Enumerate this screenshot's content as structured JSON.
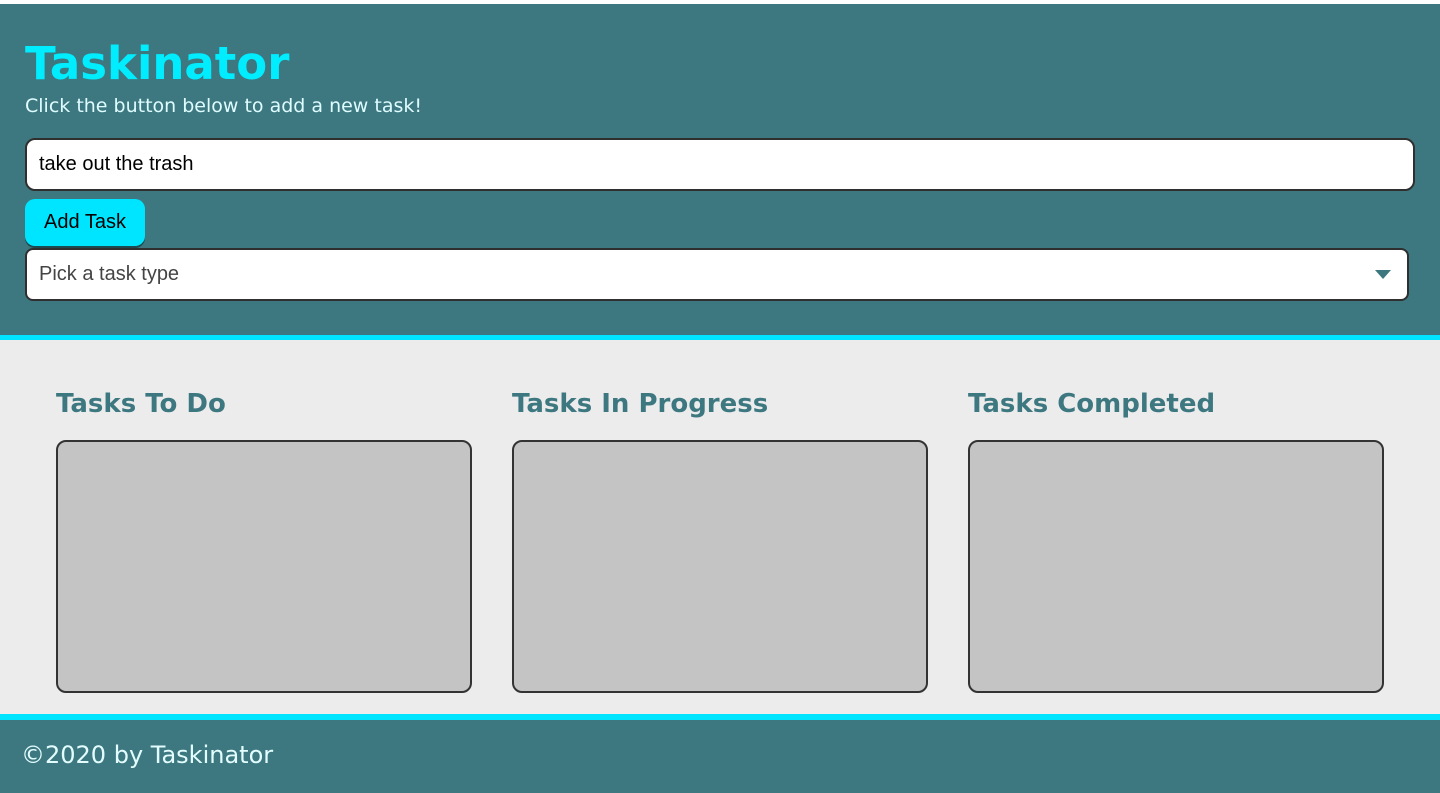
{
  "header": {
    "title": "Taskinator",
    "subtitle": "Click the button below to add a new task!"
  },
  "form": {
    "task_name_value": "take out the trash",
    "add_task_label": "Add Task",
    "task_type_selected": "Pick a task type"
  },
  "columns": [
    {
      "title": "Tasks To Do",
      "tasks": []
    },
    {
      "title": "Tasks In Progress",
      "tasks": []
    },
    {
      "title": "Tasks Completed",
      "tasks": []
    }
  ],
  "footer": {
    "text": "©2020 by Taskinator"
  },
  "colors": {
    "header_bg": "#3d7881",
    "accent": "#00e5ff",
    "title": "#00ecff",
    "page_bg": "#ececec",
    "task_list_bg": "#c4c4c4"
  },
  "icons": {
    "select_arrow": "chevron-down-icon"
  }
}
